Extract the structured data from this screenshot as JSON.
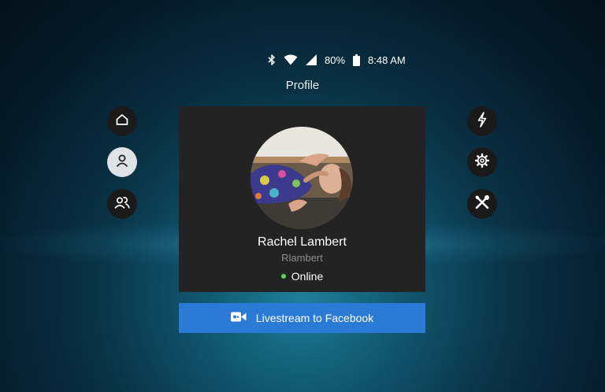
{
  "status_bar": {
    "battery_percent": "80%",
    "time": "8:48 AM",
    "icons": [
      "bluetooth-icon",
      "wifi-icon",
      "signal-icon",
      "battery-icon"
    ]
  },
  "page_title": "Profile",
  "left_nav": [
    {
      "name": "home",
      "icon": "home-icon",
      "active": false
    },
    {
      "name": "profile",
      "icon": "user-icon",
      "active": true
    },
    {
      "name": "friends",
      "icon": "friends-icon",
      "active": false
    }
  ],
  "right_nav": [
    {
      "name": "quick-actions",
      "icon": "lightning-icon"
    },
    {
      "name": "settings",
      "icon": "gear-icon"
    },
    {
      "name": "tools",
      "icon": "tools-icon"
    }
  ],
  "profile": {
    "name": "Rachel Lambert",
    "username": "Rlambert",
    "status": "Online",
    "status_color": "#5fd35f"
  },
  "livestream_button": {
    "label": "Livestream to Facebook",
    "icon": "video-camera-icon",
    "color": "#2a7ad6"
  }
}
